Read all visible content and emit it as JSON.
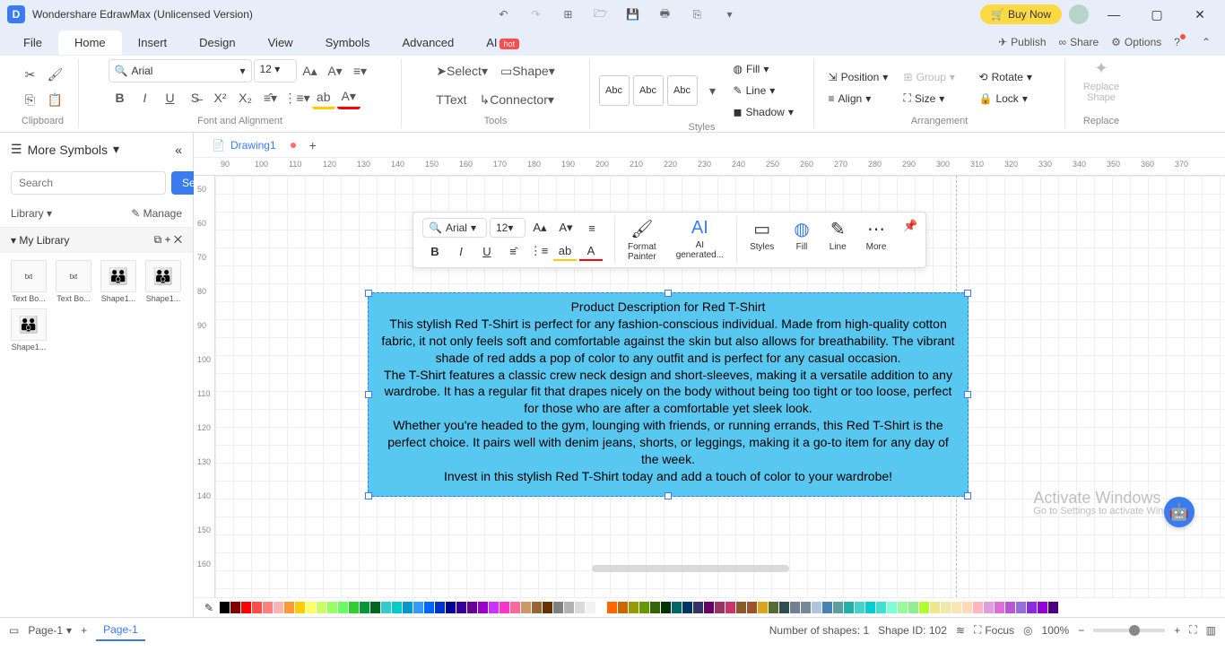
{
  "app": {
    "title": "Wondershare EdrawMax (Unlicensed Version)",
    "buy_now": "Buy Now"
  },
  "tabs": {
    "file": "File",
    "home": "Home",
    "insert": "Insert",
    "design": "Design",
    "view": "View",
    "symbols": "Symbols",
    "advanced": "Advanced",
    "ai": "AI",
    "hot": "hot"
  },
  "menubar_right": {
    "publish": "Publish",
    "share": "Share",
    "options": "Options"
  },
  "ribbon": {
    "clipboard": "Clipboard",
    "font_align": "Font and Alignment",
    "tools": "Tools",
    "styles": "Styles",
    "arrangement": "Arrangement",
    "replace": "Replace",
    "font_name": "Arial",
    "font_size": "12",
    "select": "Select",
    "shape": "Shape",
    "text": "Text",
    "connector": "Connector",
    "theme_abc": "Abc",
    "fill": "Fill",
    "line": "Line",
    "shadow": "Shadow",
    "position": "Position",
    "align": "Align",
    "group": "Group",
    "size": "Size",
    "rotate": "Rotate",
    "lock": "Lock",
    "replace_shape": "Replace\nShape"
  },
  "sidebar": {
    "more_symbols": "More Symbols",
    "search_ph": "Search",
    "search_btn": "Search",
    "library": "Library",
    "manage": "Manage",
    "my_library": "My Library",
    "shapes": [
      "Text Bo...",
      "Text Bo...",
      "Shape1...",
      "Shape1...",
      "Shape1..."
    ]
  },
  "document": {
    "tab_name": "Drawing1"
  },
  "float": {
    "font_name": "Arial",
    "font_size": "12",
    "format_painter": "Format\nPainter",
    "ai_generated": "AI\ngenerated...",
    "styles": "Styles",
    "fill": "Fill",
    "line": "Line",
    "more": "More"
  },
  "textbox": {
    "title": "Product Description for Red T-Shirt",
    "p1": "This stylish Red T-Shirt is perfect for any fashion-conscious individual. Made from high-quality cotton fabric, it not only feels soft and comfortable against the skin but also allows for breathability. The vibrant shade of red adds a pop of color to any outfit and is perfect for any casual occasion.",
    "p2": "The T-Shirt features a classic crew neck design and short-sleeves, making it a versatile addition to any wardrobe. It has a regular fit that drapes nicely on the body without being too tight or too loose, perfect for those who are after a comfortable yet sleek look.",
    "p3": "Whether you're headed to the gym, lounging with friends, or running errands, this Red T-Shirt is the perfect choice. It pairs well with denim jeans, shorts, or leggings, making it a go-to item for any day of the week.",
    "p4": "Invest in this stylish Red T-Shirt today and add a touch of color to your wardrobe!"
  },
  "ruler_h": [
    "90",
    "100",
    "110",
    "120",
    "130",
    "140",
    "150",
    "160",
    "170",
    "180",
    "190",
    "200",
    "210",
    "220",
    "230",
    "240",
    "250",
    "260",
    "270",
    "280",
    "290",
    "300",
    "310",
    "320",
    "330",
    "340",
    "350",
    "360",
    "370"
  ],
  "ruler_v": [
    "50",
    "60",
    "70",
    "80",
    "90",
    "100",
    "110",
    "120",
    "130",
    "140",
    "150",
    "160"
  ],
  "watermark": {
    "title": "Activate Windows",
    "sub": "Go to Settings to activate Windows."
  },
  "status": {
    "page_sel": "Page-1",
    "page_tab": "Page-1",
    "num_shapes": "Number of shapes: 1",
    "shape_id": "Shape ID: 102",
    "focus": "Focus",
    "zoom": "100%"
  },
  "colors": [
    "#000000",
    "#800000",
    "#ff0000",
    "#ff4d4d",
    "#ff8080",
    "#ffb3b3",
    "#ff9933",
    "#ffcc00",
    "#ffff66",
    "#ccff66",
    "#99ff66",
    "#66ff66",
    "#33cc33",
    "#009933",
    "#006622",
    "#33cccc",
    "#00cccc",
    "#0099cc",
    "#3399ff",
    "#0066ff",
    "#0033cc",
    "#000099",
    "#330099",
    "#660099",
    "#9900cc",
    "#cc33ff",
    "#ff33cc",
    "#ff6699",
    "#cc9966",
    "#996633",
    "#663300",
    "#808080",
    "#b3b3b3",
    "#d9d9d9",
    "#f2f2f2",
    "#ffffff",
    "#ff6600",
    "#cc6600",
    "#999900",
    "#669900",
    "#336600",
    "#003300",
    "#006666",
    "#003366",
    "#333366",
    "#660066",
    "#993366",
    "#cc3366",
    "#8b5a2b",
    "#a0522d",
    "#daa520",
    "#556b2f",
    "#2f4f4f",
    "#708090",
    "#778899",
    "#b0c4de",
    "#4682b4",
    "#5f9ea0",
    "#20b2aa",
    "#48d1cc",
    "#00ced1",
    "#40e0d0",
    "#7fffd4",
    "#98fb98",
    "#90ee90",
    "#adff2f",
    "#f0e68c",
    "#eee8aa",
    "#ffe4b5",
    "#ffdab9",
    "#ffb6c1",
    "#dda0dd",
    "#da70d6",
    "#ba55d3",
    "#9370db",
    "#8a2be2",
    "#9400d3",
    "#4b0082"
  ]
}
